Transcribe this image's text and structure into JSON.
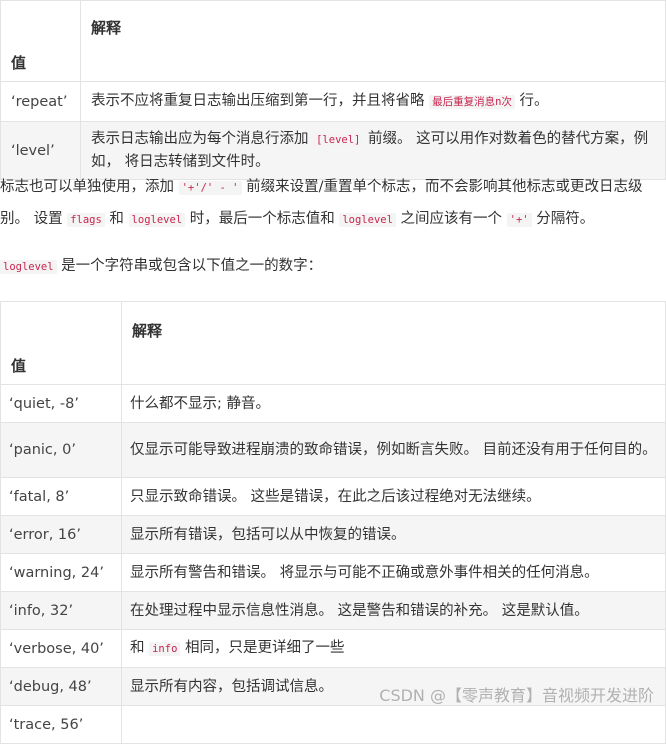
{
  "table1": {
    "headers": [
      "值",
      "解释"
    ],
    "rows": [
      {
        "value": "‘repeat’",
        "pre": "表示不应将重复日志输出压缩到第一行，并且将省略 ",
        "code": "最后重复消息n次",
        "post": " 行。"
      },
      {
        "value": "‘level’",
        "pre": "表示日志输出应为每个消息行添加 ",
        "code": "[level]",
        "post": " 前缀。 这可以用作对数着色的替代方案，例如， 将日志转储到文件时。"
      }
    ]
  },
  "para1": {
    "t1": "标志也可以单独使用，添加 ",
    "c1": "'+'/' - '",
    "t2": " 前缀来设置/重置单个标志，而不会影响其他标志或更改日志级别。 设置 ",
    "c2": "flags",
    "t3": " 和 ",
    "c3": "loglevel",
    "t4": " 时，最后一个标志值和 ",
    "c4": "loglevel",
    "t5": " 之间应该有一个 ",
    "c5": "'+'",
    "t6": " 分隔符。"
  },
  "para2": {
    "c1": "loglevel",
    "t1": " 是一个字符串或包含以下值之一的数字："
  },
  "table2": {
    "headers": [
      "值",
      "解释"
    ],
    "rows": [
      {
        "value": "‘quiet, -8’",
        "pre": "什么都不显示; 静音。",
        "code": "",
        "post": ""
      },
      {
        "value": "‘panic, 0’",
        "pre": "仅显示可能导致进程崩溃的致命错误，例如断言失败。 目前还没有用于任何目的。",
        "code": "",
        "post": ""
      },
      {
        "value": "‘fatal, 8’",
        "pre": "只显示致命错误。 这些是错误，在此之后该过程绝对无法继续。",
        "code": "",
        "post": ""
      },
      {
        "value": "‘error, 16’",
        "pre": "显示所有错误，包括可以从中恢复的错误。",
        "code": "",
        "post": ""
      },
      {
        "value": "‘warning, 24’",
        "pre": "显示所有警告和错误。 将显示与可能不正确或意外事件相关的任何消息。",
        "code": "",
        "post": ""
      },
      {
        "value": "‘info, 32’",
        "pre": "在处理过程中显示信息性消息。 这是警告和错误的补充。 这是默认值。",
        "code": "",
        "post": ""
      },
      {
        "value": "‘verbose, 40’",
        "pre": "和 ",
        "code": "info",
        "post": " 相同，只是更详细了一些"
      },
      {
        "value": "‘debug, 48’",
        "pre": "显示所有内容，包括调试信息。",
        "code": "",
        "post": ""
      },
      {
        "value": "‘trace, 56’",
        "pre": "",
        "code": "",
        "post": ""
      }
    ]
  },
  "watermark": "CSDN @【零声教育】音视频开发进阶"
}
